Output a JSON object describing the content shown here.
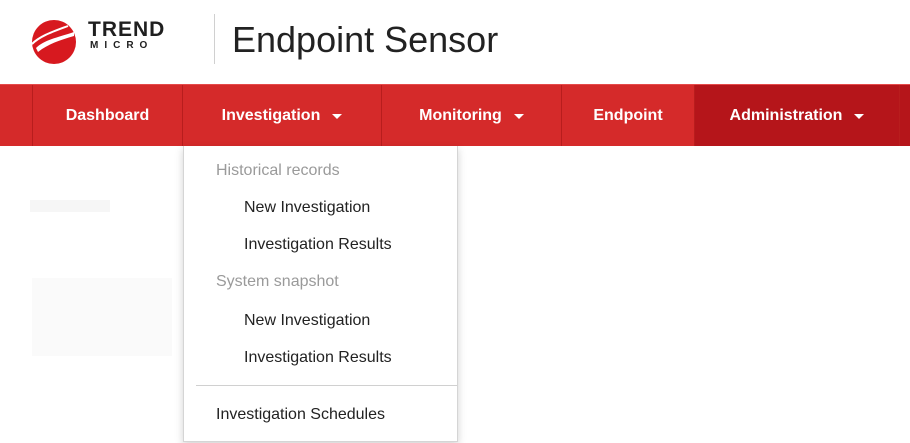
{
  "brand": {
    "logo_line1": "TREND",
    "logo_line2": "MICRO",
    "app_title": "Endpoint Sensor",
    "brand_red": "#d52a2a"
  },
  "nav": {
    "items": [
      {
        "label": "Dashboard",
        "has_caret": false
      },
      {
        "label": "Investigation",
        "has_caret": true
      },
      {
        "label": "Monitoring",
        "has_caret": true
      },
      {
        "label": "Endpoint",
        "has_caret": false
      },
      {
        "label": "Administration",
        "has_caret": true
      }
    ]
  },
  "dropdown": {
    "section1_header": "Historical records",
    "section1_items": [
      "New Investigation",
      "Investigation Results"
    ],
    "section2_header": "System snapshot",
    "section2_items": [
      "New Investigation",
      "Investigation Results"
    ],
    "footer_item": "Investigation Schedules"
  }
}
